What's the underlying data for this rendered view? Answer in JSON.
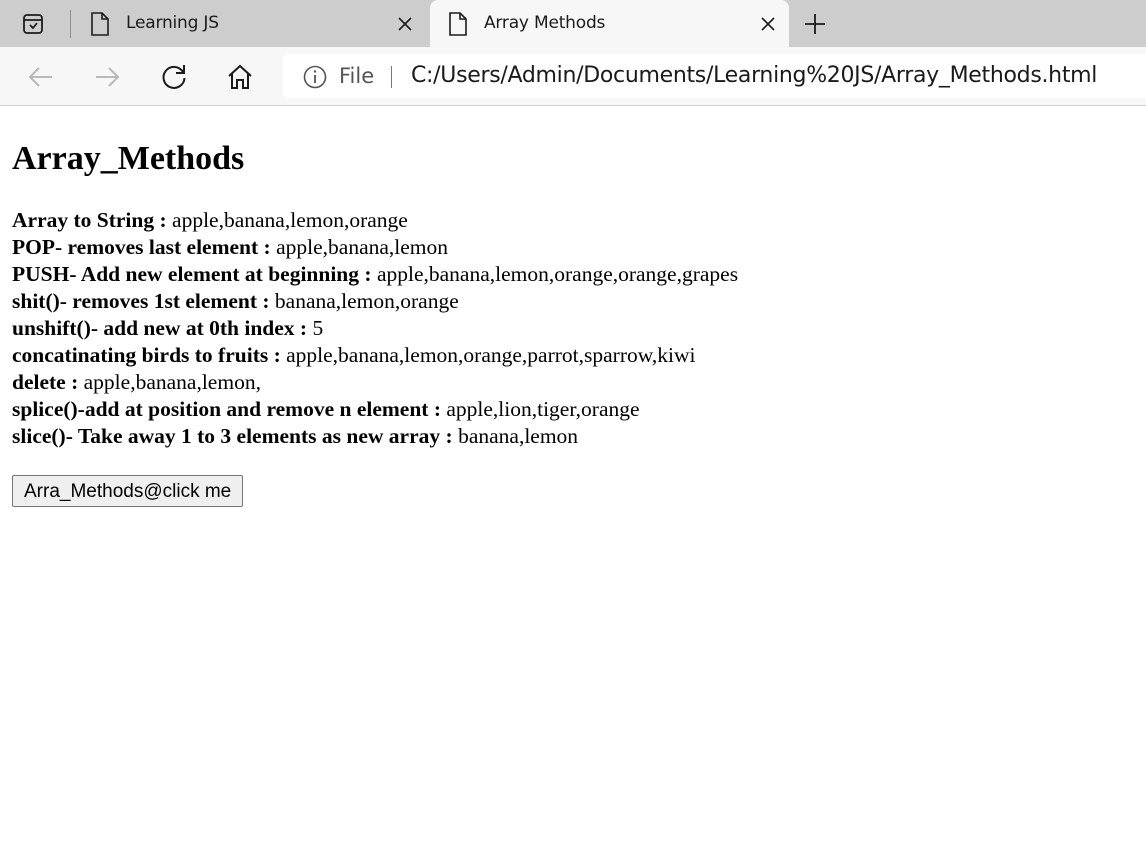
{
  "browser": {
    "tabs": [
      {
        "label": "Learning JS",
        "active": false,
        "icon": "page-icon"
      },
      {
        "label": "Array Methods",
        "active": true,
        "icon": "page-icon"
      }
    ],
    "address": {
      "scheme": "File",
      "url": "C:/Users/Admin/Documents/Learning%20JS/Array_Methods.html"
    }
  },
  "page": {
    "heading": "Array_Methods",
    "lines": [
      {
        "label": "Array to String : ",
        "value": "apple,banana,lemon,orange"
      },
      {
        "label": "POP- removes last element : ",
        "value": "apple,banana,lemon"
      },
      {
        "label": "PUSH- Add new element at beginning : ",
        "value": "apple,banana,lemon,orange,orange,grapes"
      },
      {
        "label": "shit()- removes 1st element : ",
        "value": "banana,lemon,orange"
      },
      {
        "label": "unshift()- add new at 0th index : ",
        "value": "5"
      },
      {
        "label": "concatinating birds to fruits : ",
        "value": "apple,banana,lemon,orange,parrot,sparrow,kiwi"
      },
      {
        "label": "delete : ",
        "value": "apple,banana,lemon,"
      },
      {
        "label": "splice()-add at position and remove n element : ",
        "value": "apple,lion,tiger,orange"
      },
      {
        "label": "slice()- Take away 1 to 3 elements as new array : ",
        "value": "banana,lemon"
      }
    ],
    "button_label": "Arra_Methods@click me"
  }
}
